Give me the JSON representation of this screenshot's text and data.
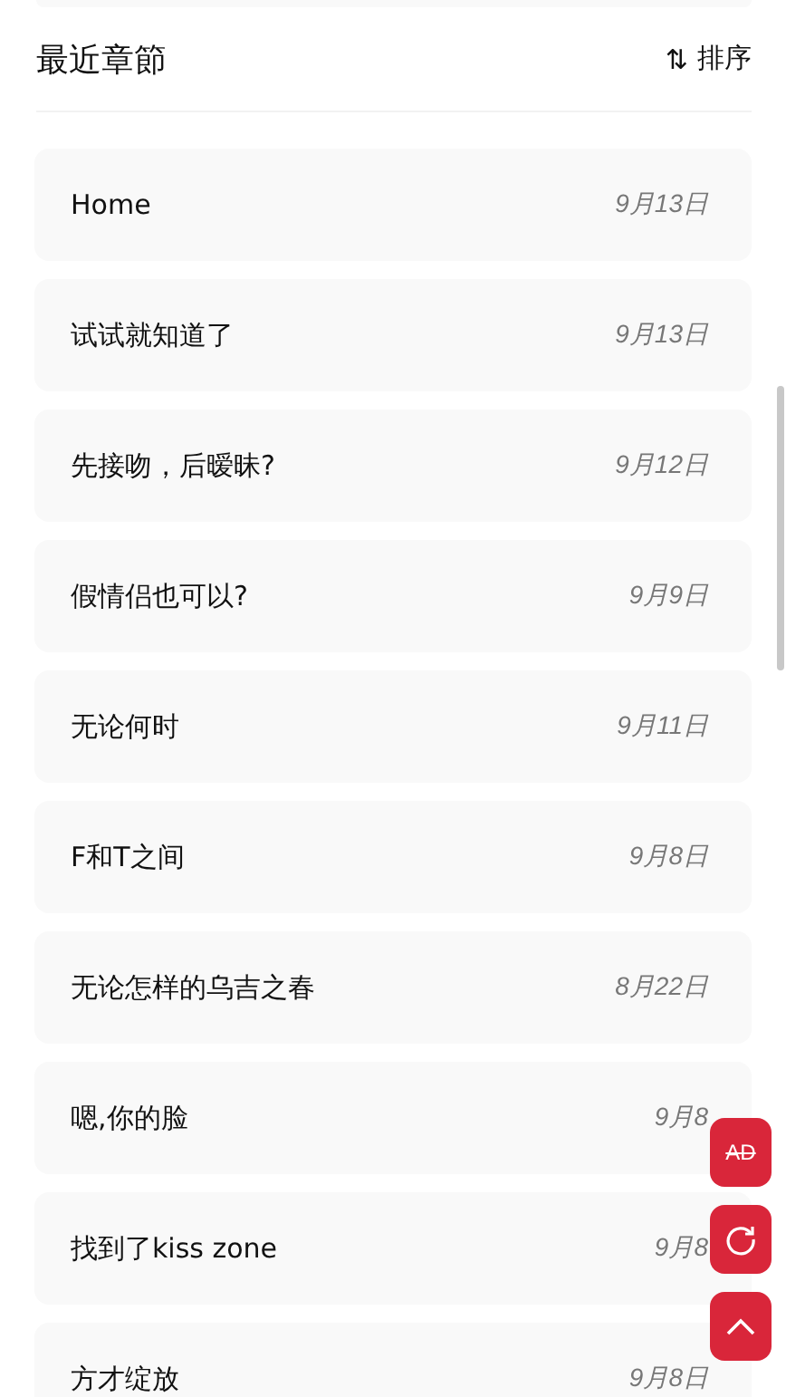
{
  "section": {
    "title": "最近章節",
    "sort_button": {
      "icon": "⇅",
      "label": "排序"
    }
  },
  "chapters": [
    {
      "title": "Home",
      "date": "9月13日"
    },
    {
      "title": "试试就知道了",
      "date": "9月13日"
    },
    {
      "title": "先接吻，后暧昧?",
      "date": "9月12日"
    },
    {
      "title": "假情侣也可以?",
      "date": "9月9日"
    },
    {
      "title": "无论何时",
      "date": "9月11日"
    },
    {
      "title": "F和T之间",
      "date": "9月8日"
    },
    {
      "title": "无论怎样的乌吉之春",
      "date": "8月22日"
    },
    {
      "title": "嗯,你的脸",
      "date": "9月8"
    },
    {
      "title": "找到了kiss zone",
      "date": "9月8"
    },
    {
      "title": "方才绽放",
      "date": "9月8日"
    }
  ],
  "floating_buttons": [
    {
      "kind": "ad",
      "label": "AD"
    },
    {
      "kind": "refresh"
    },
    {
      "kind": "top"
    }
  ]
}
